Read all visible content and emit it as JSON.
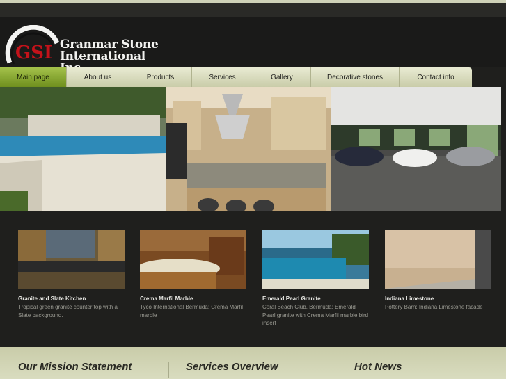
{
  "brand": {
    "logo_letters": "GSI",
    "name_line1": "Granmar Stone",
    "name_line2": "International Inc."
  },
  "nav": {
    "items": [
      {
        "label": "Main page",
        "active": true
      },
      {
        "label": "About us",
        "active": false
      },
      {
        "label": "Products",
        "active": false
      },
      {
        "label": "Services",
        "active": false
      },
      {
        "label": "Gallery",
        "active": false
      },
      {
        "label": "Decorative stones",
        "active": false
      },
      {
        "label": "Contact info",
        "active": false
      }
    ]
  },
  "thumbs": [
    {
      "title": "Granite and Slate Kitchen",
      "desc": "Tropical green granite counter top with a Slate background."
    },
    {
      "title": "Crema Marfil Marble",
      "desc": "Tyco International Bermuda: Crema Marfil marble"
    },
    {
      "title": "Emerald Pearl Granite",
      "desc": "Coral Beach Club, Bermuda:  Emerald Pearl granite with Crema Marfil marble bird insert"
    },
    {
      "title": "Indiana Limestone",
      "desc": "Pottery Barn:  Indiana Limestone facade"
    }
  ],
  "bottom": {
    "mission": "Our Mission Statement",
    "services": "Services Overview",
    "news": "Hot News"
  },
  "colors": {
    "accent_green": "#8aab2f",
    "nav_bg": "#d8dbbd",
    "page_bg": "#1f1f1d",
    "logo_red": "#c4121a"
  }
}
